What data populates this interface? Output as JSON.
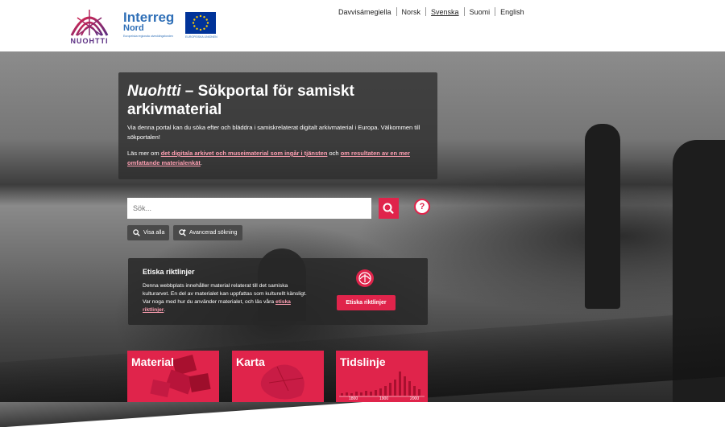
{
  "header": {
    "nuohtti_logo_text": "NUOHTTI",
    "interreg_title": "Interreg",
    "interreg_sub": "Nord",
    "interreg_tag": "Europeiska regionala utvecklingsfonden",
    "eu_label": "EUROPEISKA UNIONEN",
    "languages": [
      {
        "label": "Davvisámegiella",
        "active": false
      },
      {
        "label": "Norsk",
        "active": false
      },
      {
        "label": "Svenska",
        "active": true
      },
      {
        "label": "Suomi",
        "active": false
      },
      {
        "label": "English",
        "active": false
      }
    ]
  },
  "intro": {
    "title_em": "Nuohtti",
    "title_rest": " – Sökportal för samiskt arkivmaterial",
    "para1": "Via denna portal kan du söka efter och bläddra i samiskrelaterat digitalt arkivmaterial i Europa. Välkommen till sökportalen!",
    "para2_prefix": "Läs mer om ",
    "para2_link1": "det digitala arkivet och museimaterial som ingår i tjänsten",
    "para2_mid": " och ",
    "para2_link2": "om resultaten av en mer omfattande materialenkät",
    "para2_suffix": "."
  },
  "search": {
    "placeholder": "Sök...",
    "help_icon": "question-icon"
  },
  "buttons": {
    "show_all": "Visa alla",
    "advanced": "Avancerad sökning"
  },
  "ethics": {
    "title": "Etiska riktlinjer",
    "body": "Denna webbplats innehåller material relaterat till det samiska kulturarvet. En del av materialet kan uppfattas som kulturellt känsligt. Var noga med hur du använder materialet, och läs våra ",
    "link": "etiska riktlinjer",
    "body_end": ".",
    "button": "Etiska riktlinjer"
  },
  "cards": [
    {
      "title": "Material"
    },
    {
      "title": "Karta"
    },
    {
      "title": "Tidslinje",
      "axis_labels": [
        "1800",
        "1900",
        "2000"
      ]
    }
  ],
  "colors": {
    "accent": "#e0244b",
    "link": "#ff9fb2",
    "interreg_blue": "#2f6fb7",
    "nuohtti_purple": "#5a2d82"
  }
}
